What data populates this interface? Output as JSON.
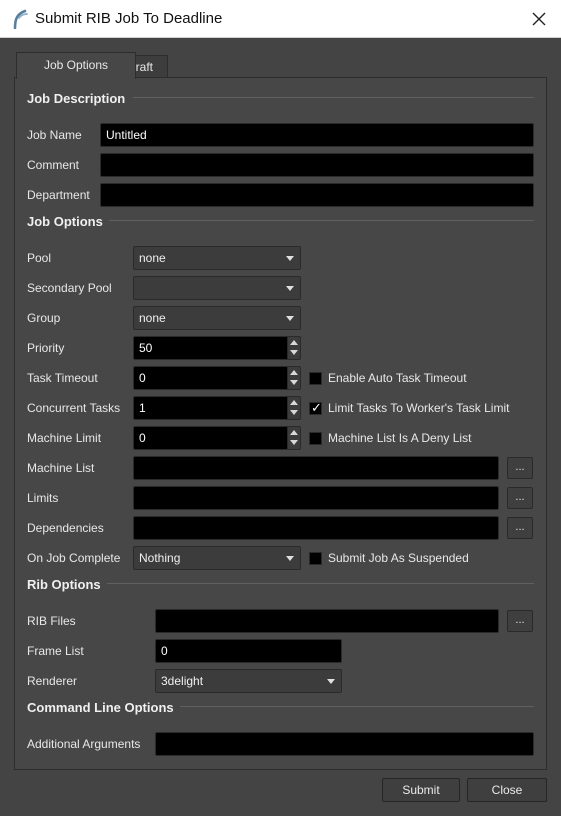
{
  "window": {
    "title": "Submit RIB Job To Deadline",
    "logo_icon": "deadline-logo-icon",
    "close_icon": "close-icon"
  },
  "tabs": [
    {
      "label": "Job Options",
      "active": true
    },
    {
      "label": "Draft",
      "active": false
    }
  ],
  "job_description": {
    "header": "Job Description",
    "job_name": {
      "label": "Job Name",
      "value": "Untitled"
    },
    "comment": {
      "label": "Comment",
      "value": ""
    },
    "department": {
      "label": "Department",
      "value": ""
    }
  },
  "job_options": {
    "header": "Job Options",
    "pool": {
      "label": "Pool",
      "value": "none"
    },
    "secondary_pool": {
      "label": "Secondary Pool",
      "value": ""
    },
    "group": {
      "label": "Group",
      "value": "none"
    },
    "priority": {
      "label": "Priority",
      "value": "50"
    },
    "task_timeout": {
      "label": "Task Timeout",
      "value": "0"
    },
    "auto_task_timeout": {
      "label": "Enable Auto Task Timeout",
      "checked": false
    },
    "concurrent_tasks": {
      "label": "Concurrent Tasks",
      "value": "1"
    },
    "limit_tasks": {
      "label": "Limit Tasks To Worker's Task Limit",
      "checked": true
    },
    "machine_limit": {
      "label": "Machine Limit",
      "value": "0"
    },
    "deny_list": {
      "label": "Machine List Is A Deny List",
      "checked": false
    },
    "machine_list": {
      "label": "Machine List",
      "value": ""
    },
    "limits": {
      "label": "Limits",
      "value": ""
    },
    "dependencies": {
      "label": "Dependencies",
      "value": ""
    },
    "on_job_complete": {
      "label": "On Job Complete",
      "value": "Nothing"
    },
    "suspended": {
      "label": "Submit Job As Suspended",
      "checked": false
    },
    "browse_label": "..."
  },
  "rib_options": {
    "header": "Rib Options",
    "rib_files": {
      "label": "RIB Files",
      "value": ""
    },
    "frame_list": {
      "label": "Frame List",
      "value": "0"
    },
    "renderer": {
      "label": "Renderer",
      "value": "3delight"
    }
  },
  "command_line": {
    "header": "Command Line Options",
    "additional_arguments": {
      "label": "Additional Arguments",
      "value": ""
    }
  },
  "buttons": {
    "submit": "Submit",
    "close": "Close"
  },
  "check_glyph": "✓"
}
